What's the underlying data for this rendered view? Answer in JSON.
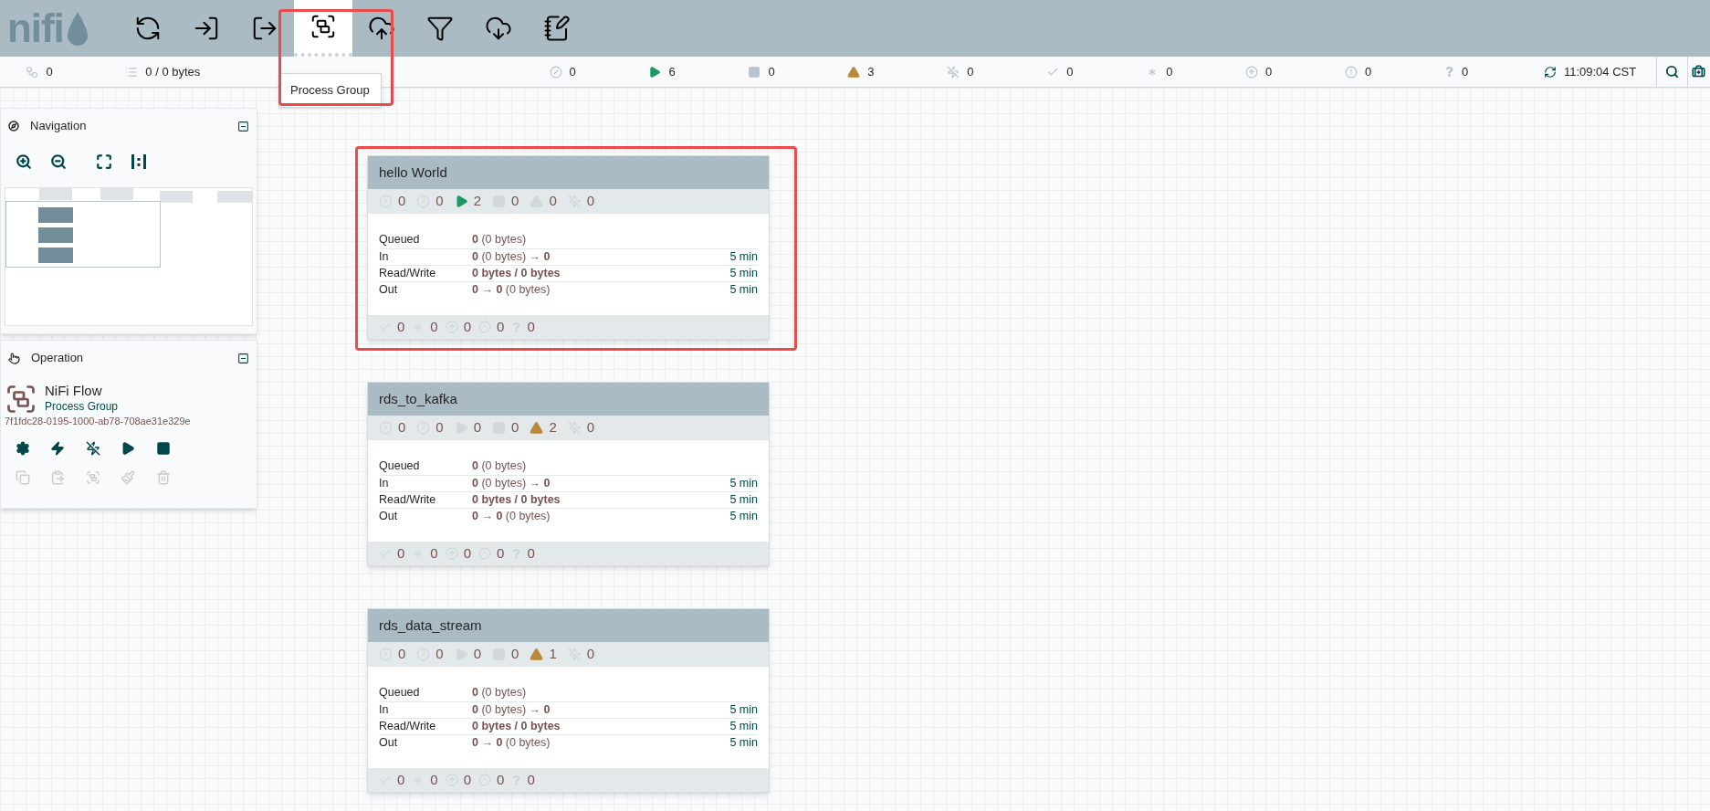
{
  "toolbar": {
    "logo": "nifi",
    "tools": [
      {
        "kind": "processor",
        "selected": false
      },
      {
        "kind": "input-port",
        "selected": false
      },
      {
        "kind": "output-port",
        "selected": false
      },
      {
        "kind": "process-group",
        "selected": true
      },
      {
        "kind": "remote-group",
        "selected": false
      },
      {
        "kind": "funnel",
        "selected": false
      },
      {
        "kind": "template",
        "selected": false
      },
      {
        "kind": "label",
        "selected": false
      }
    ],
    "tooltip": "Process Group"
  },
  "status_bar": {
    "items": [
      {
        "kind": "threads",
        "value": "0"
      },
      {
        "kind": "queued",
        "value": "0 / 0 bytes"
      },
      {
        "kind": "hidden"
      },
      {
        "kind": "not-transmitting",
        "value": "0"
      },
      {
        "kind": "running",
        "value": "6"
      },
      {
        "kind": "stopped",
        "value": "0"
      },
      {
        "kind": "invalid",
        "value": "3"
      },
      {
        "kind": "disabled",
        "value": "0"
      },
      {
        "kind": "up-to-date",
        "value": "0"
      },
      {
        "kind": "modified",
        "value": "0"
      },
      {
        "kind": "stale",
        "value": "0"
      },
      {
        "kind": "sync-failure",
        "value": "0"
      },
      {
        "kind": "unknown",
        "value": "0"
      },
      {
        "kind": "refresh",
        "value": "11:09:04 CST"
      }
    ]
  },
  "navigation": {
    "title": "Navigation"
  },
  "operation": {
    "title": "Operation",
    "component_name": "NiFi Flow",
    "component_type": "Process Group",
    "component_id": "7f1fdc28-0195-1000-ab78-708ae31e329e",
    "buttons": [
      {
        "kind": "configure",
        "disabled": false
      },
      {
        "kind": "enable",
        "disabled": false
      },
      {
        "kind": "disable",
        "disabled": false
      },
      {
        "kind": "start",
        "disabled": false
      },
      {
        "kind": "stop",
        "disabled": false
      },
      {
        "kind": "copy",
        "disabled": true
      },
      {
        "kind": "paste",
        "disabled": true
      },
      {
        "kind": "group",
        "disabled": true
      },
      {
        "kind": "color",
        "disabled": true
      },
      {
        "kind": "delete",
        "disabled": true
      }
    ]
  },
  "process_groups": [
    {
      "name": "hello World",
      "stats": [
        {
          "kind": "transmitting",
          "value": "0",
          "active": false
        },
        {
          "kind": "not-transmitting",
          "value": "0",
          "active": false
        },
        {
          "kind": "running",
          "value": "2",
          "active": true
        },
        {
          "kind": "stopped",
          "value": "0",
          "active": false
        },
        {
          "kind": "invalid",
          "value": "0",
          "active": false
        },
        {
          "kind": "disabled",
          "value": "0",
          "active": false
        }
      ],
      "rows": [
        {
          "kind": "plain",
          "label": "Queued",
          "value": "**0** (0 bytes)"
        },
        {
          "kind": "plain",
          "label": "In",
          "value": "**0** (0 bytes) → **0**",
          "time": "5 min"
        },
        {
          "kind": "bold",
          "label": "Read/Write",
          "value": "0 bytes / 0 bytes",
          "time": "5 min"
        },
        {
          "kind": "plain",
          "label": "Out",
          "value": "**0 → 0** (0 bytes)",
          "time": "5 min"
        }
      ],
      "versions": [
        {
          "kind": "up-to-date",
          "value": "0"
        },
        {
          "kind": "modified",
          "value": "0"
        },
        {
          "kind": "stale",
          "value": "0"
        },
        {
          "kind": "sync-failure",
          "value": "0"
        },
        {
          "kind": "unknown",
          "value": "0"
        }
      ]
    },
    {
      "name": "rds_to_kafka",
      "stats": [
        {
          "kind": "transmitting",
          "value": "0",
          "active": false
        },
        {
          "kind": "not-transmitting",
          "value": "0",
          "active": false
        },
        {
          "kind": "running",
          "value": "0",
          "active": false
        },
        {
          "kind": "stopped",
          "value": "0",
          "active": false
        },
        {
          "kind": "invalid",
          "value": "2",
          "active": true
        },
        {
          "kind": "disabled",
          "value": "0",
          "active": false
        }
      ],
      "rows": [
        {
          "kind": "plain",
          "label": "Queued",
          "value": "**0** (0 bytes)"
        },
        {
          "kind": "plain",
          "label": "In",
          "value": "**0** (0 bytes) → **0**",
          "time": "5 min"
        },
        {
          "kind": "bold",
          "label": "Read/Write",
          "value": "0 bytes / 0 bytes",
          "time": "5 min"
        },
        {
          "kind": "plain",
          "label": "Out",
          "value": "**0 → 0** (0 bytes)",
          "time": "5 min"
        }
      ],
      "versions": [
        {
          "kind": "up-to-date",
          "value": "0"
        },
        {
          "kind": "modified",
          "value": "0"
        },
        {
          "kind": "stale",
          "value": "0"
        },
        {
          "kind": "sync-failure",
          "value": "0"
        },
        {
          "kind": "unknown",
          "value": "0"
        }
      ]
    },
    {
      "name": "rds_data_stream",
      "stats": [
        {
          "kind": "transmitting",
          "value": "0",
          "active": false
        },
        {
          "kind": "not-transmitting",
          "value": "0",
          "active": false
        },
        {
          "kind": "running",
          "value": "0",
          "active": false
        },
        {
          "kind": "stopped",
          "value": "0",
          "active": false
        },
        {
          "kind": "invalid",
          "value": "1",
          "active": true
        },
        {
          "kind": "disabled",
          "value": "0",
          "active": false
        }
      ],
      "rows": [
        {
          "kind": "plain",
          "label": "Queued",
          "value": "**0** (0 bytes)"
        },
        {
          "kind": "plain",
          "label": "In",
          "value": "**0** (0 bytes) → **0**",
          "time": "5 min"
        },
        {
          "kind": "bold",
          "label": "Read/Write",
          "value": "0 bytes / 0 bytes",
          "time": "5 min"
        },
        {
          "kind": "plain",
          "label": "Out",
          "value": "**0 → 0** (0 bytes)",
          "time": "5 min"
        }
      ],
      "versions": [
        {
          "kind": "up-to-date",
          "value": "0"
        },
        {
          "kind": "modified",
          "value": "0"
        },
        {
          "kind": "stale",
          "value": "0"
        },
        {
          "kind": "sync-failure",
          "value": "0"
        },
        {
          "kind": "unknown",
          "value": "0"
        }
      ]
    }
  ]
}
